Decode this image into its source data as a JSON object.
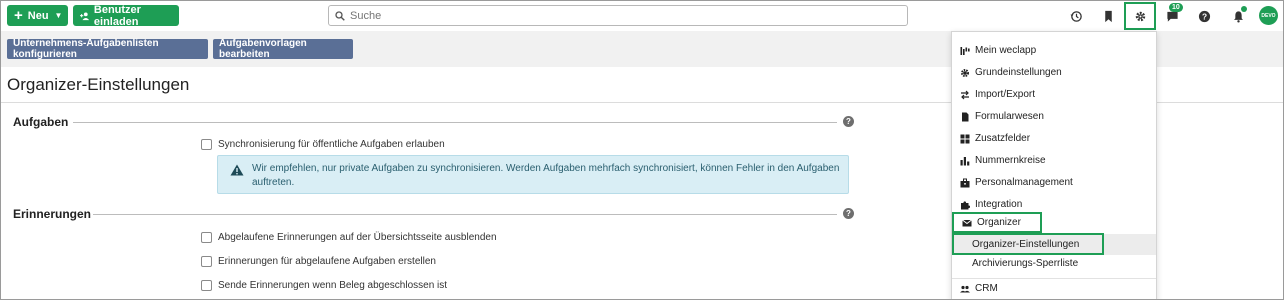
{
  "topbar": {
    "new_label": "Neu",
    "invite_label": "Benutzer einladen",
    "search_placeholder": "Suche",
    "chat_badge": "10",
    "avatar_text": "DEVO"
  },
  "subbar": {
    "configure_label": "Unternehmens-Aufgabenlisten konfigurieren",
    "templates_label": "Aufgabenvorlagen bearbeiten"
  },
  "page": {
    "title": "Organizer-Einstellungen",
    "sections": {
      "tasks": {
        "heading": "Aufgaben",
        "sync_label": "Synchronisierung für öffentliche Aufgaben erlauben",
        "alert_text": "Wir empfehlen, nur private Aufgaben zu synchronisieren. Werden Aufgaben mehrfach synchronisiert, können Fehler in den Aufgaben auftreten."
      },
      "reminders": {
        "heading": "Erinnerungen",
        "options": [
          "Abgelaufene Erinnerungen auf der Übersichtsseite ausblenden",
          "Erinnerungen für abgelaufene Aufgaben erstellen",
          "Sende Erinnerungen wenn Beleg abgeschlossen ist"
        ]
      }
    }
  },
  "menu": {
    "items": [
      {
        "label": "Mein weclapp",
        "icon": "chart-icon"
      },
      {
        "label": "Grundeinstellungen",
        "icon": "gear-icon"
      },
      {
        "label": "Import/Export",
        "icon": "swap-icon"
      },
      {
        "label": "Formularwesen",
        "icon": "document-icon"
      },
      {
        "label": "Zusatzfelder",
        "icon": "grid-icon"
      },
      {
        "label": "Nummernkreise",
        "icon": "bar-chart-icon"
      },
      {
        "label": "Personalmanagement",
        "icon": "briefcase-icon"
      },
      {
        "label": "Integration",
        "icon": "puzzle-icon"
      },
      {
        "label": "Organizer",
        "icon": "mail-icon"
      },
      {
        "label": "Organizer-Einstellungen",
        "icon": ""
      },
      {
        "label": "Archivierungs-Sperrliste",
        "icon": ""
      },
      {
        "label": "CRM",
        "icon": "people-icon"
      }
    ]
  },
  "colors": {
    "accent": "#1e9e55",
    "secondary_button": "#5a6f96",
    "alert_bg": "#d9eef5"
  }
}
